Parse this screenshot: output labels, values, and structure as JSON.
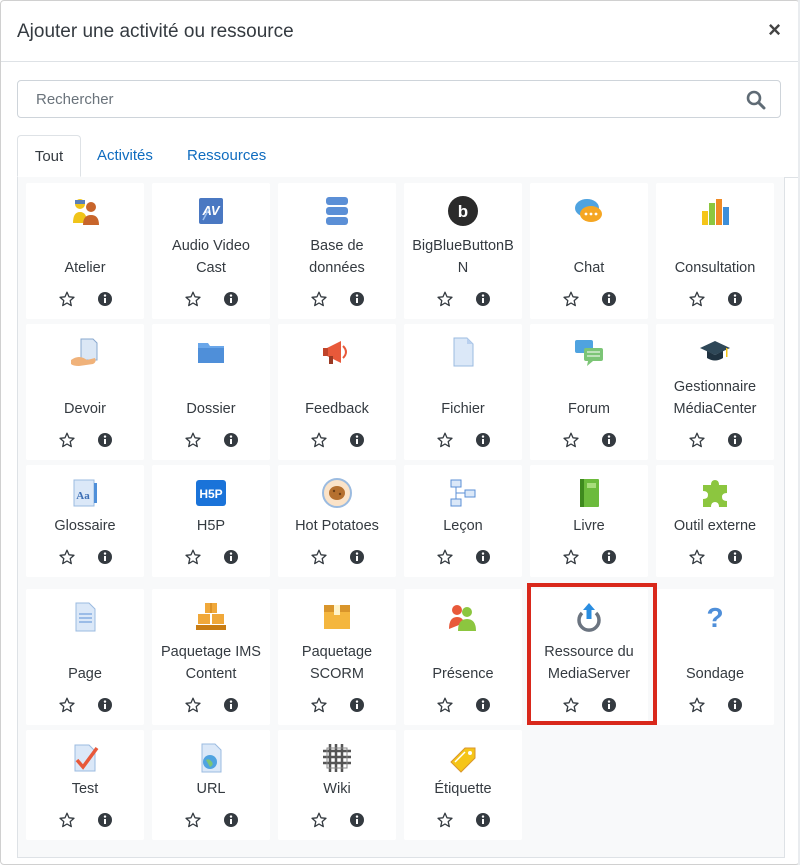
{
  "modal": {
    "title": "Ajouter une activité ou ressource",
    "close_label": "×"
  },
  "search": {
    "placeholder": "Rechercher"
  },
  "tabs": [
    {
      "label": "Tout",
      "active": true
    },
    {
      "label": "Activités",
      "active": false
    },
    {
      "label": "Ressources",
      "active": false
    }
  ],
  "items": [
    {
      "label": "Atelier",
      "icon": "workshop-icon"
    },
    {
      "label": "Audio Video Cast",
      "icon": "audio-video-cast-icon"
    },
    {
      "label": "Base de données",
      "icon": "database-icon"
    },
    {
      "label": "BigBlueButtonBN",
      "icon": "bigbluebutton-icon"
    },
    {
      "label": "Chat",
      "icon": "chat-icon"
    },
    {
      "label": "Consultation",
      "icon": "bar-chart-icon"
    },
    {
      "label": "Devoir",
      "icon": "assignment-icon"
    },
    {
      "label": "Dossier",
      "icon": "folder-icon"
    },
    {
      "label": "Feedback",
      "icon": "megaphone-icon"
    },
    {
      "label": "Fichier",
      "icon": "file-icon"
    },
    {
      "label": "Forum",
      "icon": "forum-icon"
    },
    {
      "label": "Gestionnaire MédiaCenter",
      "icon": "graduation-cap-icon"
    },
    {
      "label": "Glossaire",
      "icon": "glossary-icon"
    },
    {
      "label": "H5P",
      "icon": "h5p-icon"
    },
    {
      "label": "Hot Potatoes",
      "icon": "hot-potatoes-icon"
    },
    {
      "label": "Leçon",
      "icon": "lesson-icon"
    },
    {
      "label": "Livre",
      "icon": "book-icon"
    },
    {
      "label": "Outil externe",
      "icon": "puzzle-icon"
    },
    {
      "label": "Page",
      "icon": "page-icon"
    },
    {
      "label": "Paquetage IMS Content",
      "icon": "ims-package-icon"
    },
    {
      "label": "Paquetage SCORM",
      "icon": "scorm-package-icon"
    },
    {
      "label": "Présence",
      "icon": "attendance-icon"
    },
    {
      "label": "Ressource du MediaServer",
      "icon": "mediaserver-icon"
    },
    {
      "label": "Sondage",
      "icon": "question-icon"
    },
    {
      "label": "Test",
      "icon": "quiz-icon"
    },
    {
      "label": "URL",
      "icon": "url-icon"
    },
    {
      "label": "Wiki",
      "icon": "wiki-icon"
    },
    {
      "label": "Étiquette",
      "icon": "label-tag-icon"
    }
  ],
  "colors": {
    "link": "#0f6cbf",
    "highlight": "#d9281b",
    "tile_bg": "#ffffff",
    "grid_bg": "#f8f9fa"
  }
}
